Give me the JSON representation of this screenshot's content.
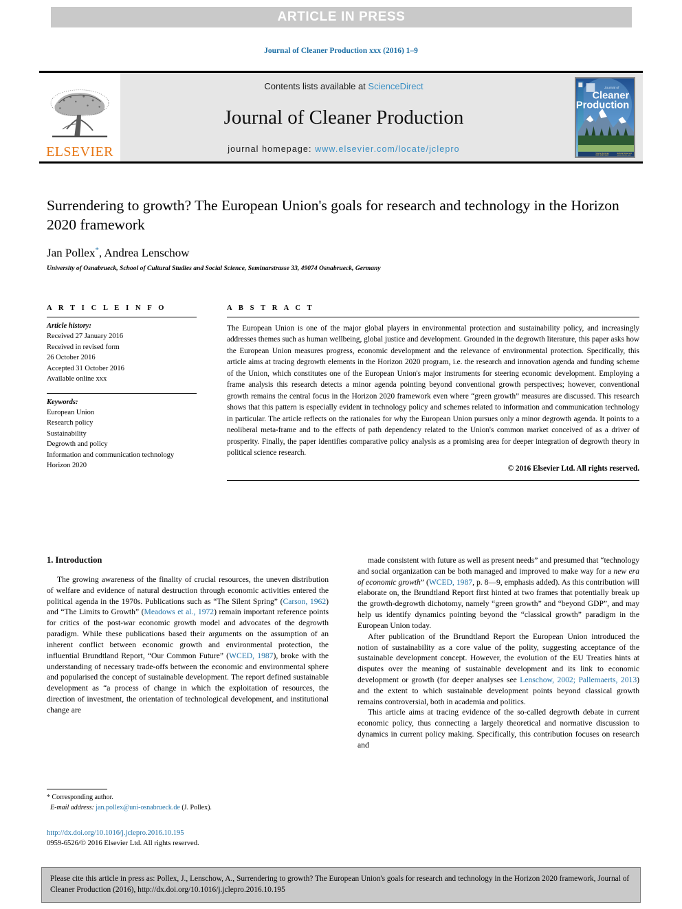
{
  "banner": {
    "text": "ARTICLE IN PRESS"
  },
  "runhead": {
    "text": "Journal of Cleaner Production xxx (2016) 1–9"
  },
  "masthead": {
    "contents_prefix": "Contents lists available at ",
    "sciencedirect": "ScienceDirect",
    "journal_title": "Journal of Cleaner Production",
    "homepage_prefix": "journal homepage: ",
    "homepage_url": "www.elsevier.com/locate/jclepro",
    "publisher_wordmark": "ELSEVIER",
    "cover_title_line1": "Journal of",
    "cover_title_line2": "Cleaner",
    "cover_title_line3": "Production",
    "link_color": "#3a8fc4",
    "elsevier_orange": "#e77817"
  },
  "article": {
    "title": "Surrendering to growth? The European Union's goals for research and technology in the Horizon 2020 framework",
    "authors": "Jan Pollex, Andrea Lenschow",
    "author_first": "Jan Pollex",
    "author_rest": ", Andrea Lenschow",
    "corresponding_marker": "*",
    "affiliation": "University of Osnabrueck, School of Cultural Studies and Social Science, Seminarstrasse 33, 49074 Osnabrueck, Germany"
  },
  "info": {
    "label": "A R T I C L E   I N F O",
    "history_label": "Article history:",
    "history": [
      "Received 27 January 2016",
      "Received in revised form",
      "26 October 2016",
      "Accepted 31 October 2016",
      "Available online xxx"
    ],
    "keywords_label": "Keywords:",
    "keywords": [
      "European Union",
      "Research policy",
      "Sustainability",
      "Degrowth and policy",
      "Information and communication technology",
      "Horizon 2020"
    ]
  },
  "abstract": {
    "label": "A B S T R A C T",
    "text": "The European Union is one of the major global players in environmental protection and sustainability policy, and increasingly addresses themes such as human wellbeing, global justice and development. Grounded in the degrowth literature, this paper asks how the European Union measures progress, economic development and the relevance of environmental protection. Specifically, this article aims at tracing degrowth elements in the Horizon 2020 program, i.e. the research and innovation agenda and funding scheme of the Union, which constitutes one of the European Union's major instruments for steering economic development. Employing a frame analysis this research detects a minor agenda pointing beyond conventional growth perspectives; however, conventional growth remains the central focus in the Horizon 2020 framework even where “green growth” measures are discussed. This research shows that this pattern is especially evident in technology policy and schemes related to information and communication technology in particular. The article reflects on the rationales for why the European Union pursues only a minor degrowth agenda. It points to a neoliberal meta-frame and to the effects of path dependency related to the Union's common market conceived of as a driver of prosperity. Finally, the paper identifies comparative policy analysis as a promising area for deeper integration of degrowth theory in political science research.",
    "copyright": "© 2016 Elsevier Ltd. All rights reserved."
  },
  "body": {
    "section_heading": "1. Introduction",
    "left_paragraphs": [
      {
        "segments": [
          {
            "t": "The growing awareness of the finality of crucial resources, the uneven distribution of welfare and evidence of natural destruction through economic activities entered the political agenda in the 1970s. Publications such as “The Silent Spring” (",
            "s": "plain"
          },
          {
            "t": "Carson, 1962",
            "s": "cite"
          },
          {
            "t": ") and “The Limits to Growth” (",
            "s": "plain"
          },
          {
            "t": "Meadows et al., 1972",
            "s": "cite"
          },
          {
            "t": ") remain important reference points for critics of the post-war economic growth model and advocates of the degrowth paradigm. While these publications based their arguments on the assumption of an inherent conflict between economic growth and environmental protection, the influential Brundtland Report, “Our Common Future” (",
            "s": "plain"
          },
          {
            "t": "WCED, 1987",
            "s": "cite"
          },
          {
            "t": "), broke with the understanding of necessary trade-offs between the economic and environmental sphere and popularised the concept of sustainable development. The report defined sustainable development as “a process of change in which the exploitation of resources, the direction of investment, the orientation of technological development, and institutional change are",
            "s": "plain"
          }
        ]
      }
    ],
    "right_paragraphs": [
      {
        "segments": [
          {
            "t": "made consistent with future as well as present needs” and presumed that “technology and social organization can be both managed and improved to make way for a ",
            "s": "plain"
          },
          {
            "t": "new era of economic growth",
            "s": "ital"
          },
          {
            "t": "” (",
            "s": "plain"
          },
          {
            "t": "WCED, 1987",
            "s": "cite"
          },
          {
            "t": ", p. 8—9, emphasis added). As this contribution will elaborate on, the Brundtland Report first hinted at two frames that potentially break up the growth-degrowth dichotomy, namely “green growth” and “beyond GDP”, and may help us identify dynamics pointing beyond the “classical growth” paradigm in the European Union today.",
            "s": "plain"
          }
        ]
      },
      {
        "segments": [
          {
            "t": "After publication of the Brundtland Report the European Union introduced the notion of sustainability as a core value of the polity, suggesting acceptance of the sustainable development concept. However, the evolution of the EU Treaties hints at disputes over the meaning of sustainable development and its link to economic development or growth (for deeper analyses see ",
            "s": "plain"
          },
          {
            "t": "Lenschow, 2002; Pallemaerts, 2013",
            "s": "cite"
          },
          {
            "t": ") and the extent to which sustainable development points beyond classical growth remains controversial, both in academia and politics.",
            "s": "plain"
          }
        ]
      },
      {
        "segments": [
          {
            "t": "This article aims at tracing evidence of the so-called degrowth debate in current economic policy, thus connecting a largely theoretical and normative discussion to dynamics in current policy making. Specifically, this contribution focuses on research and",
            "s": "plain"
          }
        ]
      }
    ]
  },
  "footnote": {
    "corresponding": "* Corresponding author.",
    "email_label": "E-mail address:",
    "email": "jan.pollex@uni-osnabrueck.de",
    "email_suffix": "(J. Pollex)."
  },
  "doi": {
    "url": "http://dx.doi.org/10.1016/j.jclepro.2016.10.195",
    "issn_line": "0959-6526/© 2016 Elsevier Ltd. All rights reserved."
  },
  "cite_box": {
    "text": "Please cite this article in press as: Pollex, J., Lenschow, A., Surrendering to growth? The European Union's goals for research and technology in the Horizon 2020 framework, Journal of Cleaner Production (2016), http://dx.doi.org/10.1016/j.jclepro.2016.10.195"
  }
}
